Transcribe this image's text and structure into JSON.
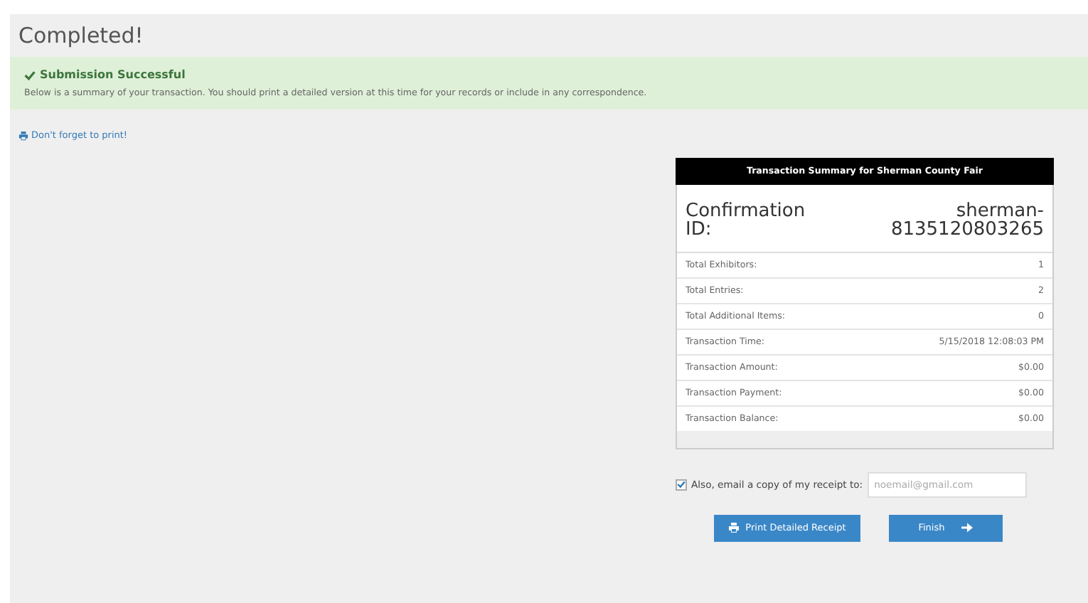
{
  "page": {
    "title": "Completed!"
  },
  "alert": {
    "title": "Submission Successful",
    "message": "Below is a summary of your transaction. You should print a detailed version at this time for your records or include in any correspondence."
  },
  "print_link": "Don't forget to print!",
  "summary": {
    "header": "Transaction Summary for Sherman County Fair",
    "confirmation_label": "Confirmation ID:",
    "confirmation_id": "sherman-8135120803265",
    "rows": [
      {
        "label": "Total Exhibitors:",
        "value": "1"
      },
      {
        "label": "Total Entries:",
        "value": "2"
      },
      {
        "label": "Total Additional Items:",
        "value": "0"
      },
      {
        "label": "Transaction Time:",
        "value": "5/15/2018 12:08:03 PM"
      },
      {
        "label": "Transaction Amount:",
        "value": "$0.00"
      },
      {
        "label": "Transaction Payment:",
        "value": "$0.00"
      },
      {
        "label": "Transaction Balance:",
        "value": "$0.00"
      }
    ]
  },
  "email": {
    "checked": true,
    "label": "Also, email a copy of my receipt to:",
    "placeholder": "noemail@gmail.com"
  },
  "buttons": [
    {
      "kind": "print",
      "label": "Print Detailed Receipt"
    },
    {
      "kind": "finish",
      "label": "Finish"
    }
  ]
}
